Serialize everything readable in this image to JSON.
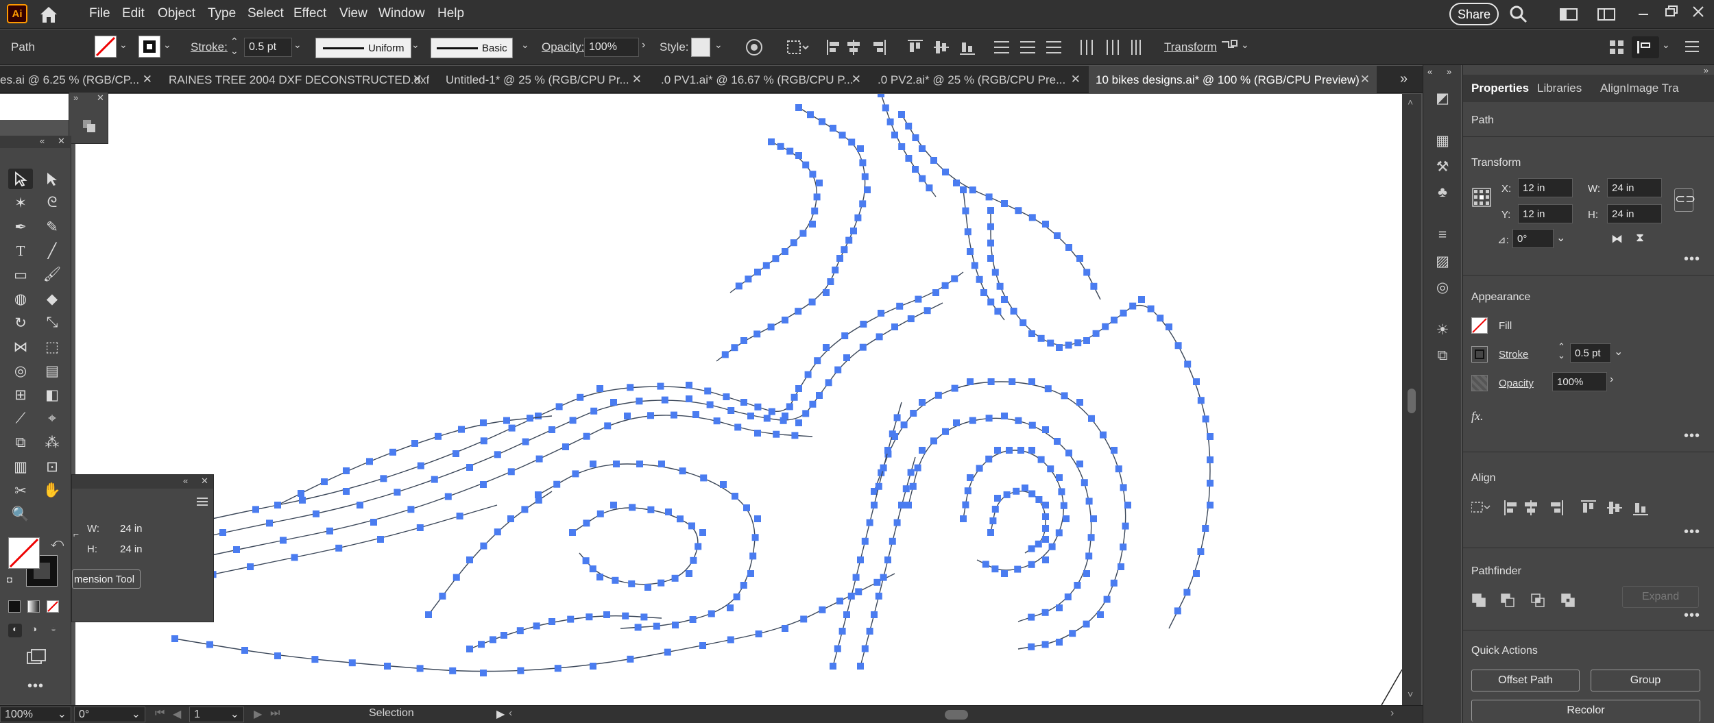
{
  "app": {
    "logo": "Ai",
    "brand_color": "#ff9a00",
    "logo_bg": "#330000"
  },
  "menu": [
    "File",
    "Edit",
    "Object",
    "Type",
    "Select",
    "Effect",
    "View",
    "Window",
    "Help"
  ],
  "share": "Share",
  "control": {
    "selection_kind": "Path",
    "stroke_label": "Stroke:",
    "stroke_weight": "0.5 pt",
    "profile": "Uniform",
    "brush": "Basic",
    "opacity_label": "Opacity:",
    "opacity": "100%",
    "style_label": "Style:",
    "transform_label": "Transform"
  },
  "tabs": [
    {
      "label": "es.ai @ 6.25 % (RGB/CP...",
      "closable": true
    },
    {
      "label": "RAINES TREE 2004 DXF DECONSTRUCTED.dxf*",
      "closable": true
    },
    {
      "label": "Untitled-1* @ 25 % (RGB/CPU Pr...",
      "closable": true
    },
    {
      "label": ".0 PV1.ai* @ 16.67 % (RGB/CPU P...",
      "closable": true
    },
    {
      "label": ".0 PV2.ai* @ 25 % (RGB/CPU Pre...",
      "closable": true
    },
    {
      "label": "10 bikes designs.ai* @ 100 % (RGB/CPU Preview)",
      "closable": true,
      "active": true
    }
  ],
  "float_panel": {
    "w_label": "W:",
    "w": "24 in",
    "h_label": "H:",
    "h": "24 in",
    "tool_button": "mension Tool"
  },
  "status": {
    "zoom": "100%",
    "rotate": "0°",
    "artboard": "1",
    "tool": "Selection"
  },
  "panel": {
    "tabs": [
      "Properties",
      "Libraries",
      "Align",
      "Image Tra"
    ],
    "kind": "Path",
    "transform": {
      "title": "Transform",
      "x_label": "X:",
      "x": "12 in",
      "y_label": "Y:",
      "y": "12 in",
      "w_label": "W:",
      "w": "24 in",
      "h_label": "H:",
      "h": "24 in",
      "angle_label": "⊿:",
      "angle": "0°"
    },
    "appearance": {
      "title": "Appearance",
      "fill": "Fill",
      "stroke": "Stroke",
      "stroke_value": "0.5 pt",
      "opacity": "Opacity",
      "opacity_value": "100%",
      "fx": "fx."
    },
    "align": {
      "title": "Align"
    },
    "pathfinder": {
      "title": "Pathfinder",
      "expand": "Expand"
    },
    "quick_actions": {
      "title": "Quick Actions",
      "offset": "Offset Path",
      "group": "Group",
      "recolor": "Recolor"
    }
  },
  "colors": {
    "anchor": "#4a7cf0",
    "path": "#3a4658"
  }
}
